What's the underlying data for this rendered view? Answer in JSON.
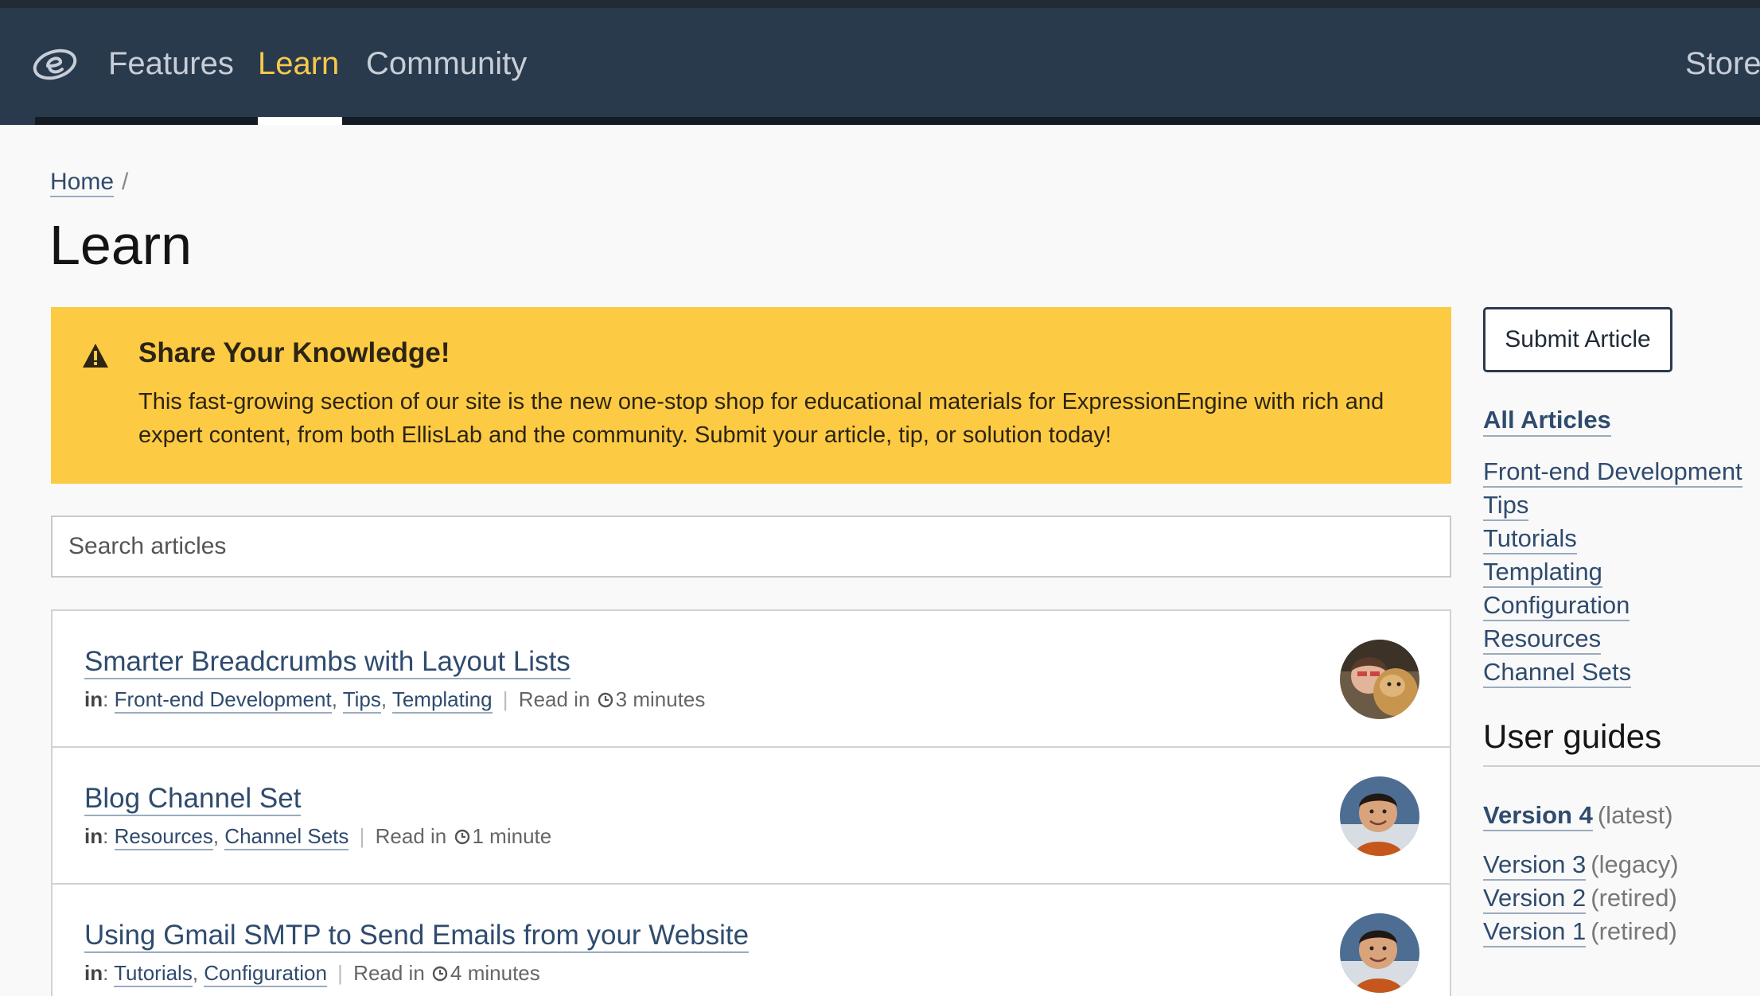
{
  "nav": {
    "items": [
      {
        "label": "Features"
      },
      {
        "label": "Learn"
      },
      {
        "label": "Community"
      }
    ],
    "store_label": "Store",
    "active_color": "#f8c94b",
    "bg_color": "#2a3a4d"
  },
  "breadcrumb": {
    "home": "Home",
    "separator": "/"
  },
  "page": {
    "title": "Learn"
  },
  "alert": {
    "icon": "warning-icon",
    "title": "Share Your Knowledge!",
    "body": "This fast-growing section of our site is the new one-stop shop for educational materials for ExpressionEngine with rich and expert content, from both EllisLab and the community. Submit your article, tip, or solution today!",
    "bg_color": "#fdca43"
  },
  "search": {
    "placeholder": "Search articles"
  },
  "articles": [
    {
      "title": "Smarter Breadcrumbs with Layout Lists",
      "in_label": "in",
      "categories": [
        "Front-end Development",
        "Tips",
        "Templating"
      ],
      "read_label": "Read in",
      "read_time": "3 minutes"
    },
    {
      "title": "Blog Channel Set",
      "in_label": "in",
      "categories": [
        "Resources",
        "Channel Sets"
      ],
      "read_label": "Read in",
      "read_time": "1 minute"
    },
    {
      "title": "Using Gmail SMTP to Send Emails from your Website",
      "in_label": "in",
      "categories": [
        "Tutorials",
        "Configuration"
      ],
      "read_label": "Read in",
      "read_time": "4 minutes"
    }
  ],
  "sidebar": {
    "submit_label": "Submit Article",
    "all_articles": "All Articles",
    "categories": [
      "Front-end Development",
      "Tips",
      "Tutorials",
      "Templating",
      "Configuration",
      "Resources",
      "Channel Sets"
    ],
    "guides_heading": "User guides",
    "versions": [
      {
        "label": "Version 4",
        "note": "(latest)"
      },
      {
        "label": "Version 3",
        "note": "(legacy)"
      },
      {
        "label": "Version 2",
        "note": "(retired)"
      },
      {
        "label": "Version 1",
        "note": "(retired)"
      }
    ]
  }
}
